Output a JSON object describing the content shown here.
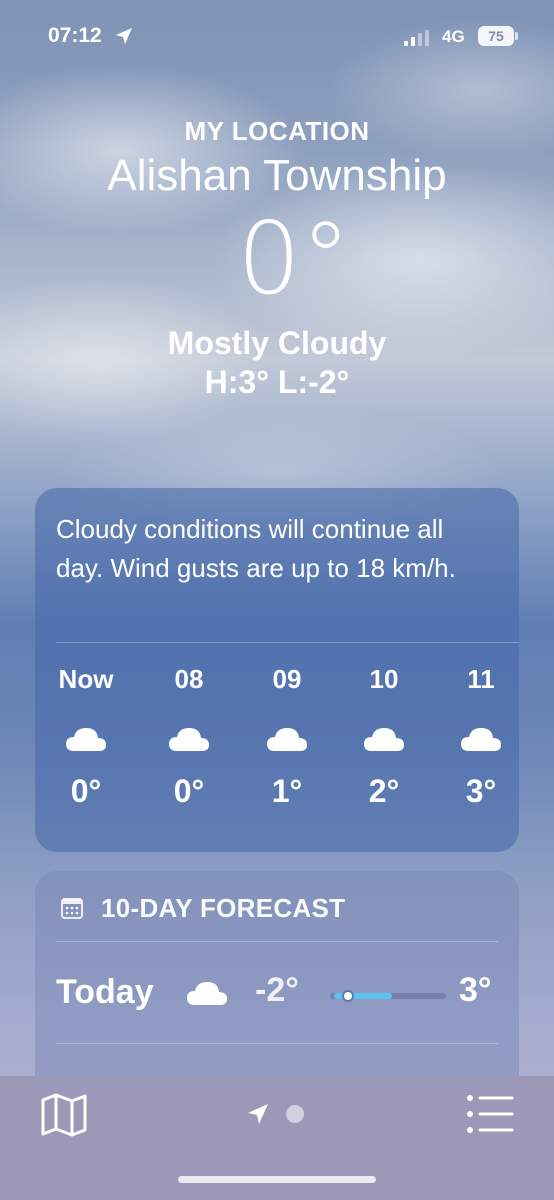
{
  "status_bar": {
    "time": "07:12",
    "network": "4G",
    "battery": "75"
  },
  "header": {
    "location_label": "MY LOCATION",
    "city": "Alishan Township",
    "temperature": "0°",
    "condition": "Mostly Cloudy",
    "high_low": "H:3°  L:-2°"
  },
  "hourly": {
    "summary": "Cloudy conditions will continue all day. Wind gusts are up to 18 km/h.",
    "hours": [
      {
        "label": "Now",
        "icon": "cloud-icon",
        "temp": "0°"
      },
      {
        "label": "08",
        "icon": "cloud-icon",
        "temp": "0°"
      },
      {
        "label": "09",
        "icon": "cloud-icon",
        "temp": "1°"
      },
      {
        "label": "10",
        "icon": "cloud-icon",
        "temp": "2°"
      },
      {
        "label": "11",
        "icon": "cloud-icon",
        "temp": "3°"
      }
    ]
  },
  "forecast": {
    "title": "10-DAY FORECAST",
    "icon": "calendar-icon",
    "days": [
      {
        "day": "Today",
        "icon": "cloud-icon",
        "low": "-2°",
        "high": "3°",
        "current_temp_position": 0.1,
        "range_start": 0.0,
        "range_end": 0.5
      }
    ]
  },
  "bottom_bar": {
    "left_icon": "map-icon",
    "center_icon": "location-arrow-icon",
    "right_icon": "list-icon"
  },
  "colors": {
    "temp_bar_fill": "#5cc2ef",
    "bottom_bar": "#9b98b8"
  }
}
